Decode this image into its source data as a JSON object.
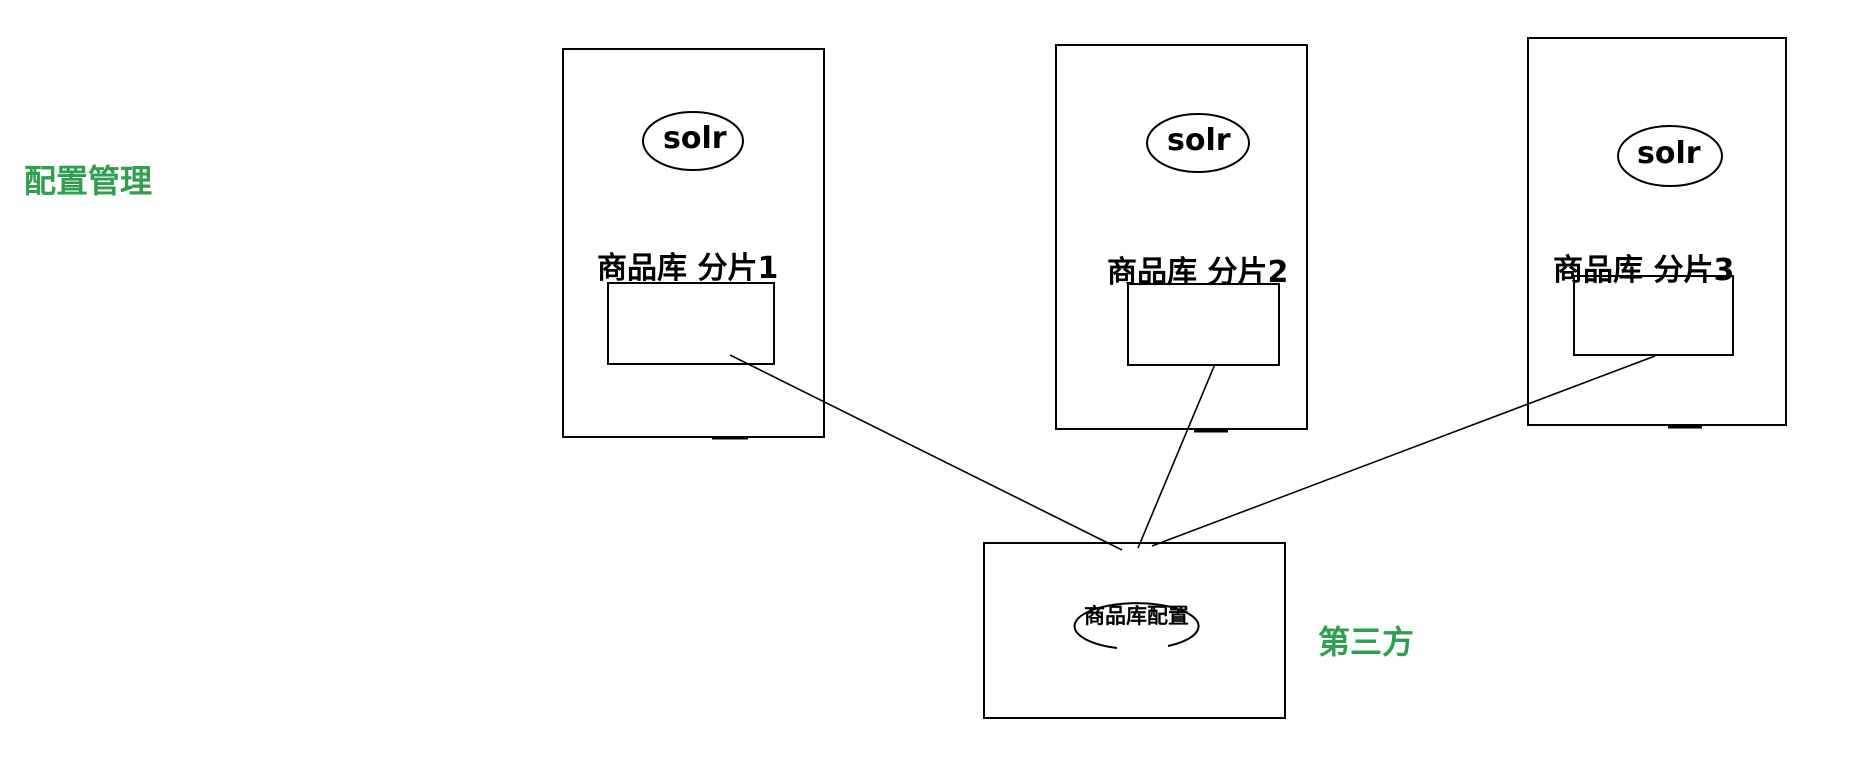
{
  "labels": {
    "config_management": "配置管理",
    "third_party": "第三方"
  },
  "nodes": [
    {
      "engine_label": "solr",
      "shard_label": "商品库 分片1"
    },
    {
      "engine_label": "solr",
      "shard_label": "商品库 分片2"
    },
    {
      "engine_label": "solr",
      "shard_label": "商品库 分片3"
    }
  ],
  "config_store": {
    "label": "商品库配置"
  },
  "colors": {
    "annotation_green": "#2e9e4f",
    "stroke": "#000000",
    "background": "#ffffff"
  }
}
